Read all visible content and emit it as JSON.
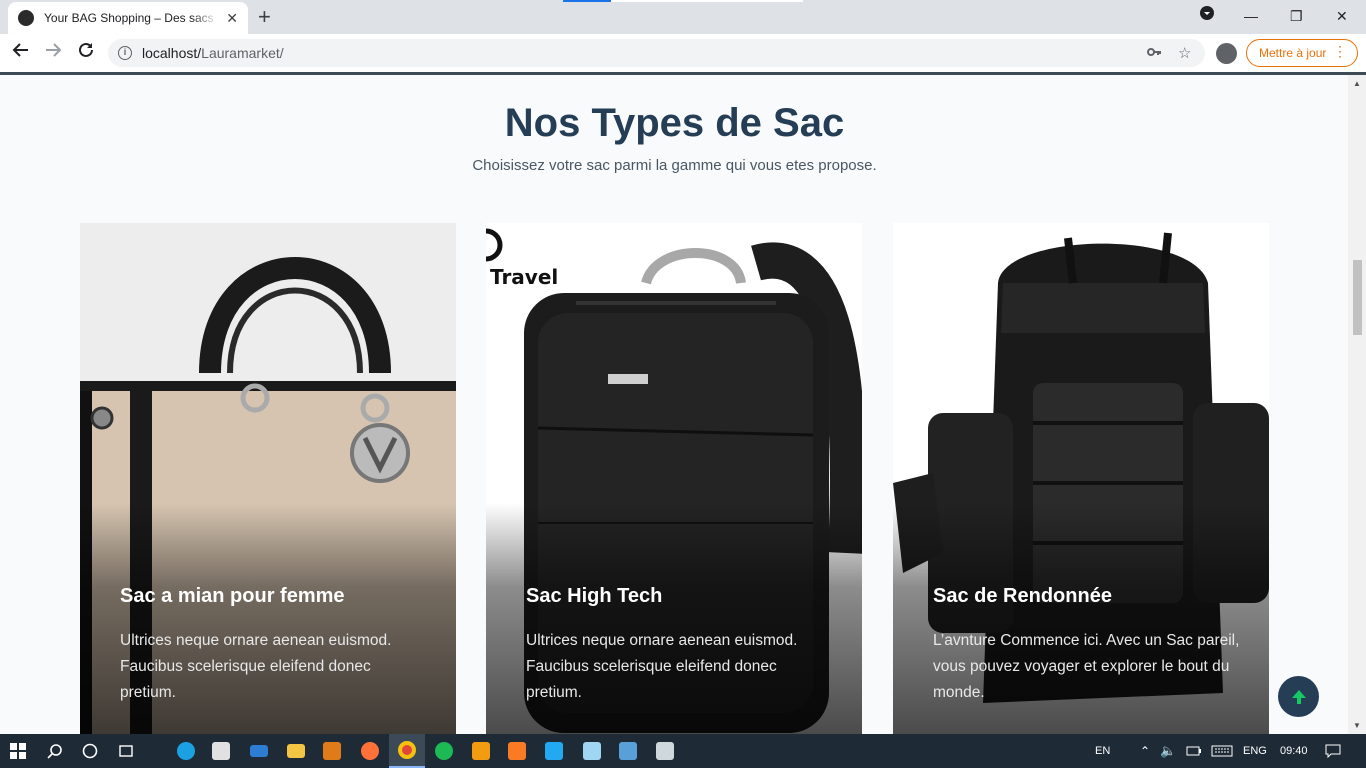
{
  "browser": {
    "tab_title": "Your BAG Shopping – Des sacs pour vous",
    "new_tab": "+",
    "url_host": "localhost/",
    "url_path": "Lauramarket/",
    "update_label": "Mettre à jour"
  },
  "section": {
    "title": "Nos Types de Sac",
    "subtitle": "Choisissez votre sac parmi la gamme qui vous etes propose."
  },
  "cards": [
    {
      "title": "Sac a mian pour femme",
      "text": "Ultrices neque ornare aenean euismod. Faucibus scelerisque eleifend donec pretium."
    },
    {
      "title": "Sac High Tech",
      "text": "Ultrices neque ornare aenean euismod. Faucibus scelerisque eleifend donec pretium.",
      "brand_text": "Travel"
    },
    {
      "title": "Sac de Rendonnée",
      "text": "L’avnture Commence ici. Avec un Sac pareil, vous pouvez voyager et explorer le bout du monde."
    }
  ],
  "taskbar": {
    "lang": "EN",
    "keyboard": "ENG",
    "time": "09:40"
  },
  "colors": {
    "heading": "#253d55",
    "accent_green": "#17c964",
    "update_orange": "#e8710a"
  }
}
